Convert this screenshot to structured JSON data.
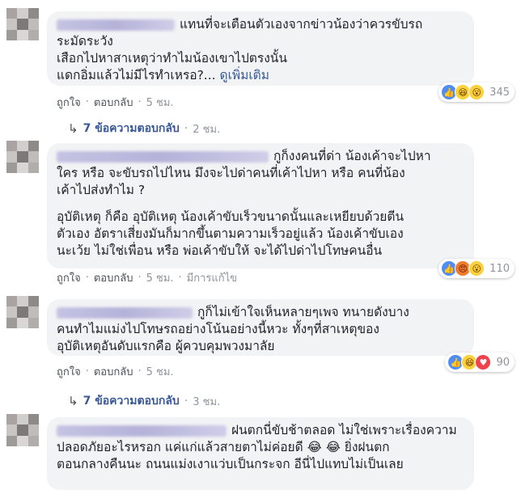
{
  "comments": [
    {
      "line1": "แทนที่จะเตือนตัวเองจากข่าวน้องว่าควรขับรถ",
      "line2": "ระมัดระวัง",
      "line3": "เสือกไปหาสาเหตุว่าทำไมน้องเขาไปตรงนั้น",
      "line4": "แดกอิ่มแล้วไม่มีไรทำเหรอ?...",
      "see_more": "ดูเพิ่มเติม",
      "reaction_count": "345",
      "reaction_icons": [
        "like-icon",
        "haha-icon",
        "wow-icon"
      ],
      "like": "ถูกใจ",
      "reply": "ตอบกลับ",
      "time": "5 ชม.",
      "replies_label": "7 ข้อความตอบกลับ",
      "replies_time": "2 ชม."
    },
    {
      "line1": "กูก็งงคนที่ด่า น้องเค้าจะไปหา",
      "line2": "ใคร หรือ จะขับรถไปไหน มึงจะไปด่าคนที่เค้าไปหา หรือ คนที่น้อง",
      "line3": "เค้าไปส่งทำไม ?",
      "line4": "อุบัติเหตุ ก็คือ อุบัติเหตุ น้องเค้าขับเร็วขนาดนั้นและเหยียบด้วยตีน",
      "line5": "ตัวเอง อัตราเสี่ยงมันก็มากขึ้นตามความเร็วอยู่แล้ว น้องเค้าขับเอง",
      "line6": "นะเว้ย ไม่ใช่เพื่อน หรือ พ่อเค้าขับให้ จะได้ไปด่าไปโทษคนอื่น",
      "reaction_count": "110",
      "reaction_icons": [
        "like-icon",
        "angry-icon",
        "wow-icon"
      ],
      "like": "ถูกใจ",
      "reply": "ตอบกลับ",
      "time": "5 ชม.",
      "edited": "มีการแก้ไข"
    },
    {
      "line1": "กูก็ไม่เข้าใจเห็นหลายๆเพจ ทนายดังบาง",
      "line2": "คนทำไมแม่งไปโทษรถอย่างโน้นอย่างนี้หวะ ทั้งๆที่สาเหตุของ",
      "line3": "อุบัติเหตุอันดับแรกคือ ผู้ควบคุมพวงมาลัย",
      "reaction_count": "90",
      "reaction_icons": [
        "like-icon",
        "haha-icon",
        "love-icon"
      ],
      "like": "ถูกใจ",
      "reply": "ตอบกลับ",
      "time": "5 ชม.",
      "replies_label": "7 ข้อความตอบกลับ",
      "replies_time": "3 ชม."
    },
    {
      "line1": "ฝนตกนี่ขับช้าตลอด ไม่ใช่เพราะเรื่องความ",
      "line2a": "ปลอดภัยอะไรหรอก แค่แก่แล้วสายตาไม่ค่อยดี",
      "line2_emoji": "😂 😂",
      "line2b": "ยิ่งฝนตก",
      "line3": "ตอนกลางคืนนะ ถนนแม่งเงาแว่บเป็นกระจก อีนี่ไปแทบไม่เป็นเลย"
    }
  ],
  "colors": {
    "bubble": "#f2f3f5",
    "link": "#385898",
    "meta": "#90949c"
  }
}
